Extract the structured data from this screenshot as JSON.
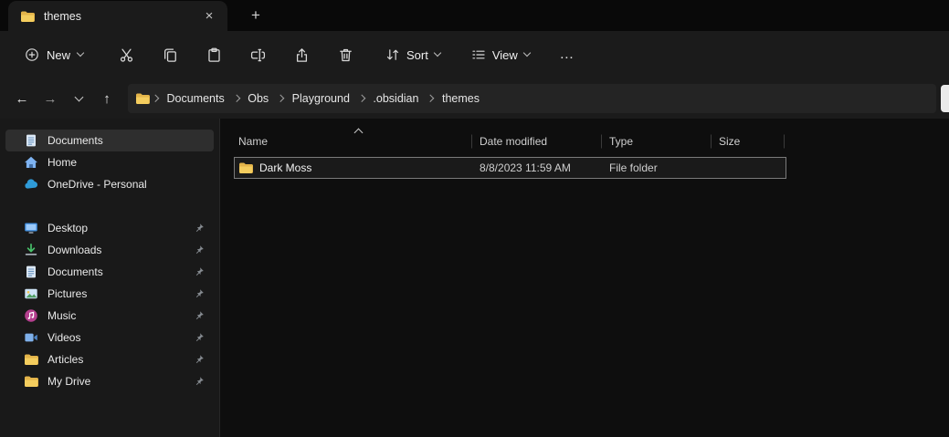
{
  "colors": {
    "folder_yellow": "#f4cd5e",
    "chrome_bg": "#1b1b1b",
    "selection_outline": "#7a7a7a",
    "onedrive_blue": "#2f9bd8"
  },
  "tab_bar": {
    "tab_title": "themes",
    "close_icon": "×",
    "new_tab_icon": "+"
  },
  "toolbar": {
    "new_label": "New",
    "icon_buttons": [
      "cut",
      "copy",
      "paste",
      "rename",
      "share",
      "delete"
    ],
    "sort_label": "Sort",
    "view_label": "View",
    "more_icon": "…"
  },
  "address_bar": {
    "back_icon": "←",
    "forward_icon": "→",
    "up_icon": "↑",
    "crumbs": [
      "Documents",
      "Obs",
      "Playground",
      ".obsidian",
      "themes"
    ]
  },
  "sidebar": {
    "items": [
      {
        "label": "Documents",
        "icon": "documents-icon",
        "selected": true,
        "pinned": false
      },
      {
        "label": "Home",
        "icon": "home-icon",
        "selected": false,
        "pinned": false
      },
      {
        "label": "OneDrive - Personal",
        "icon": "onedrive-icon",
        "selected": false,
        "pinned": false
      },
      {
        "label": "Desktop",
        "icon": "desktop-icon",
        "selected": false,
        "pinned": true
      },
      {
        "label": "Downloads",
        "icon": "downloads-icon",
        "selected": false,
        "pinned": true
      },
      {
        "label": "Documents",
        "icon": "documents-icon",
        "selected": false,
        "pinned": true
      },
      {
        "label": "Pictures",
        "icon": "pictures-icon",
        "selected": false,
        "pinned": true
      },
      {
        "label": "Music",
        "icon": "music-icon",
        "selected": false,
        "pinned": true
      },
      {
        "label": "Videos",
        "icon": "videos-icon",
        "selected": false,
        "pinned": true
      },
      {
        "label": "Articles",
        "icon": "folder-icon",
        "selected": false,
        "pinned": true
      },
      {
        "label": "My Drive",
        "icon": "folder-icon",
        "selected": false,
        "pinned": true
      }
    ]
  },
  "file_list": {
    "columns": [
      "Name",
      "Date modified",
      "Type",
      "Size"
    ],
    "rows": [
      {
        "name": "Dark Moss",
        "date_modified": "8/8/2023 11:59 AM",
        "type": "File folder",
        "size": ""
      }
    ]
  }
}
